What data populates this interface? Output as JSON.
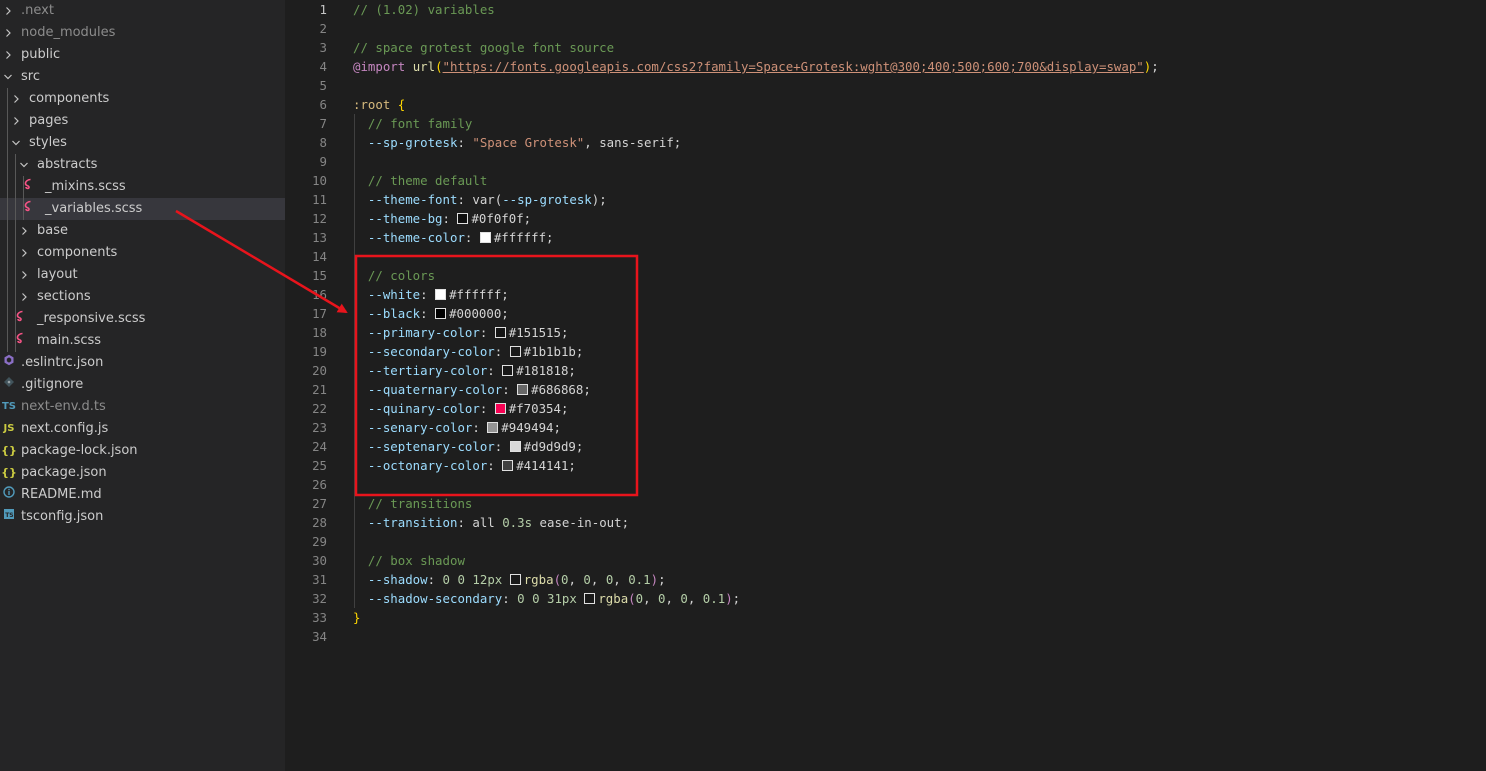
{
  "explorer": {
    "items": [
      {
        "label": ".next",
        "type": "folder",
        "depth": 0,
        "open": false,
        "dim": true
      },
      {
        "label": "node_modules",
        "type": "folder",
        "depth": 0,
        "open": false,
        "dim": true
      },
      {
        "label": "public",
        "type": "folder",
        "depth": 0,
        "open": false
      },
      {
        "label": "src",
        "type": "folder",
        "depth": 0,
        "open": true
      },
      {
        "label": "components",
        "type": "folder",
        "depth": 1,
        "open": false
      },
      {
        "label": "pages",
        "type": "folder",
        "depth": 1,
        "open": false
      },
      {
        "label": "styles",
        "type": "folder",
        "depth": 1,
        "open": true
      },
      {
        "label": "abstracts",
        "type": "folder",
        "depth": 2,
        "open": true
      },
      {
        "label": "_mixins.scss",
        "type": "file",
        "icon": "sass-icon",
        "depth": 3
      },
      {
        "label": "_variables.scss",
        "type": "file",
        "icon": "sass-icon",
        "depth": 3,
        "selected": true
      },
      {
        "label": "base",
        "type": "folder",
        "depth": 2,
        "open": false
      },
      {
        "label": "components",
        "type": "folder",
        "depth": 2,
        "open": false
      },
      {
        "label": "layout",
        "type": "folder",
        "depth": 2,
        "open": false
      },
      {
        "label": "sections",
        "type": "folder",
        "depth": 2,
        "open": false
      },
      {
        "label": "_responsive.scss",
        "type": "file",
        "icon": "sass-icon",
        "depth": 2
      },
      {
        "label": "main.scss",
        "type": "file",
        "icon": "sass-icon",
        "depth": 2
      },
      {
        "label": ".eslintrc.json",
        "type": "file",
        "icon": "eslint-icon",
        "depth": 0
      },
      {
        "label": ".gitignore",
        "type": "file",
        "icon": "git-icon",
        "depth": 0
      },
      {
        "label": "next-env.d.ts",
        "type": "file",
        "icon": "typescript-icon",
        "depth": 0,
        "dim": true
      },
      {
        "label": "next.config.js",
        "type": "file",
        "icon": "javascript-icon",
        "depth": 0
      },
      {
        "label": "package-lock.json",
        "type": "file",
        "icon": "json-icon",
        "depth": 0
      },
      {
        "label": "package.json",
        "type": "file",
        "icon": "json-icon",
        "depth": 0
      },
      {
        "label": "README.md",
        "type": "file",
        "icon": "info-icon",
        "depth": 0
      },
      {
        "label": "tsconfig.json",
        "type": "file",
        "icon": "tsconfig-icon",
        "depth": 0
      }
    ]
  },
  "editor": {
    "active_line": 1,
    "lines": [
      [
        [
          "cm",
          "// (1.02) variables"
        ]
      ],
      [],
      [
        [
          "cm",
          "// space grotest google font source"
        ]
      ],
      [
        [
          "kw",
          "@import"
        ],
        [
          "txt",
          " "
        ],
        [
          "fn",
          "url"
        ],
        [
          "br",
          "("
        ],
        [
          "strurl",
          "\"https://fonts.googleapis.com/css2?family=Space+Grotesk:wght@300;400;500;600;700&display=swap\""
        ],
        [
          "br",
          ")"
        ],
        [
          "txt",
          ";"
        ]
      ],
      [],
      [
        [
          "sel",
          ":root"
        ],
        [
          "txt",
          " "
        ],
        [
          "br",
          "{"
        ]
      ],
      [
        [
          "txt",
          "  "
        ],
        [
          "cm",
          "// font family"
        ]
      ],
      [
        [
          "txt",
          "  "
        ],
        [
          "var",
          "--sp-grotesk"
        ],
        [
          "txt",
          ": "
        ],
        [
          "str",
          "\"Space Grotesk\""
        ],
        [
          "txt",
          ", sans-serif;"
        ]
      ],
      [],
      [
        [
          "txt",
          "  "
        ],
        [
          "cm",
          "// theme default"
        ]
      ],
      [
        [
          "txt",
          "  "
        ],
        [
          "var",
          "--theme-font"
        ],
        [
          "txt",
          ": var("
        ],
        [
          "var",
          "--sp-grotesk"
        ],
        [
          "txt",
          ");"
        ]
      ],
      [
        [
          "txt",
          "  "
        ],
        [
          "var",
          "--theme-bg"
        ],
        [
          "txt",
          ": "
        ],
        [
          "swatch",
          "#0f0f0f"
        ],
        [
          "txt",
          "#0f0f0f;"
        ]
      ],
      [
        [
          "txt",
          "  "
        ],
        [
          "var",
          "--theme-color"
        ],
        [
          "txt",
          ": "
        ],
        [
          "swatch",
          "#ffffff"
        ],
        [
          "txt",
          "#ffffff;"
        ]
      ],
      [],
      [
        [
          "txt",
          "  "
        ],
        [
          "cm",
          "// colors"
        ]
      ],
      [
        [
          "txt",
          "  "
        ],
        [
          "var",
          "--white"
        ],
        [
          "txt",
          ": "
        ],
        [
          "swatch",
          "#ffffff"
        ],
        [
          "txt",
          "#ffffff;"
        ]
      ],
      [
        [
          "txt",
          "  "
        ],
        [
          "var",
          "--black"
        ],
        [
          "txt",
          ": "
        ],
        [
          "swatch",
          "#000000"
        ],
        [
          "txt",
          "#000000;"
        ]
      ],
      [
        [
          "txt",
          "  "
        ],
        [
          "var",
          "--primary-color"
        ],
        [
          "txt",
          ": "
        ],
        [
          "swatch",
          "#151515"
        ],
        [
          "txt",
          "#151515;"
        ]
      ],
      [
        [
          "txt",
          "  "
        ],
        [
          "var",
          "--secondary-color"
        ],
        [
          "txt",
          ": "
        ],
        [
          "swatch",
          "#1b1b1b"
        ],
        [
          "txt",
          "#1b1b1b;"
        ]
      ],
      [
        [
          "txt",
          "  "
        ],
        [
          "var",
          "--tertiary-color"
        ],
        [
          "txt",
          ": "
        ],
        [
          "swatch",
          "#181818"
        ],
        [
          "txt",
          "#181818;"
        ]
      ],
      [
        [
          "txt",
          "  "
        ],
        [
          "var",
          "--quaternary-color"
        ],
        [
          "txt",
          ": "
        ],
        [
          "swatch",
          "#686868"
        ],
        [
          "txt",
          "#686868;"
        ]
      ],
      [
        [
          "txt",
          "  "
        ],
        [
          "var",
          "--quinary-color"
        ],
        [
          "txt",
          ": "
        ],
        [
          "swatch",
          "#f70354"
        ],
        [
          "txt",
          "#f70354;"
        ]
      ],
      [
        [
          "txt",
          "  "
        ],
        [
          "var",
          "--senary-color"
        ],
        [
          "txt",
          ": "
        ],
        [
          "swatch",
          "#949494"
        ],
        [
          "txt",
          "#949494;"
        ]
      ],
      [
        [
          "txt",
          "  "
        ],
        [
          "var",
          "--septenary-color"
        ],
        [
          "txt",
          ": "
        ],
        [
          "swatch",
          "#d9d9d9"
        ],
        [
          "txt",
          "#d9d9d9;"
        ]
      ],
      [
        [
          "txt",
          "  "
        ],
        [
          "var",
          "--octonary-color"
        ],
        [
          "txt",
          ": "
        ],
        [
          "swatch",
          "#414141"
        ],
        [
          "txt",
          "#414141;"
        ]
      ],
      [],
      [
        [
          "txt",
          "  "
        ],
        [
          "cm",
          "// transitions"
        ]
      ],
      [
        [
          "txt",
          "  "
        ],
        [
          "var",
          "--transition"
        ],
        [
          "txt",
          ": all "
        ],
        [
          "num",
          "0.3s"
        ],
        [
          "txt",
          " ease-in-out;"
        ]
      ],
      [],
      [
        [
          "txt",
          "  "
        ],
        [
          "cm",
          "// box shadow"
        ]
      ],
      [
        [
          "txt",
          "  "
        ],
        [
          "var",
          "--shadow"
        ],
        [
          "txt",
          ": "
        ],
        [
          "num",
          "0"
        ],
        [
          "txt",
          " "
        ],
        [
          "num",
          "0"
        ],
        [
          "txt",
          " "
        ],
        [
          "num",
          "12px"
        ],
        [
          "txt",
          " "
        ],
        [
          "swatch",
          "rgba(0,0,0,0.1)"
        ],
        [
          "fn",
          "rgba"
        ],
        [
          "kw",
          "("
        ],
        [
          "num",
          "0"
        ],
        [
          "txt",
          ", "
        ],
        [
          "num",
          "0"
        ],
        [
          "txt",
          ", "
        ],
        [
          "num",
          "0"
        ],
        [
          "txt",
          ", "
        ],
        [
          "num",
          "0.1"
        ],
        [
          "kw",
          ")"
        ],
        [
          "txt",
          ";"
        ]
      ],
      [
        [
          "txt",
          "  "
        ],
        [
          "var",
          "--shadow-secondary"
        ],
        [
          "txt",
          ": "
        ],
        [
          "num",
          "0"
        ],
        [
          "txt",
          " "
        ],
        [
          "num",
          "0"
        ],
        [
          "txt",
          " "
        ],
        [
          "num",
          "31px"
        ],
        [
          "txt",
          " "
        ],
        [
          "swatch",
          "rgba(0,0,0,0.1)"
        ],
        [
          "fn",
          "rgba"
        ],
        [
          "kw",
          "("
        ],
        [
          "num",
          "0"
        ],
        [
          "txt",
          ", "
        ],
        [
          "num",
          "0"
        ],
        [
          "txt",
          ", "
        ],
        [
          "num",
          "0"
        ],
        [
          "txt",
          ", "
        ],
        [
          "num",
          "0.1"
        ],
        [
          "kw",
          ")"
        ],
        [
          "txt",
          ";"
        ]
      ],
      [
        [
          "br",
          "}"
        ]
      ],
      []
    ]
  },
  "colors": {
    "annotation": "#e8141c",
    "selection": "#37373d",
    "sass": "#f55385"
  }
}
